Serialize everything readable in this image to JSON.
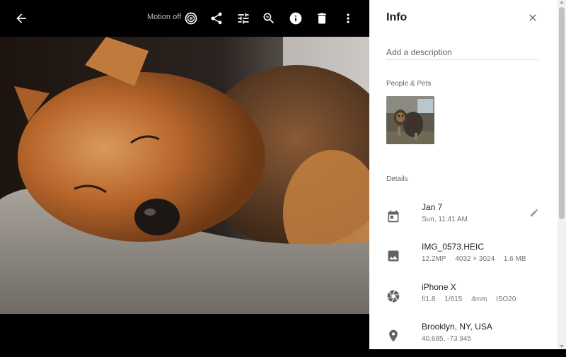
{
  "viewer": {
    "motion_label": "Motion off",
    "icons": {
      "back": "arrow-back-icon",
      "motion": "motion-photo-icon",
      "share": "share-icon",
      "edit": "tune-icon",
      "zoom": "zoom-in-icon",
      "info": "info-icon",
      "delete": "trash-icon",
      "more": "more-vert-icon"
    }
  },
  "panel": {
    "title": "Info",
    "description_placeholder": "Add a description",
    "people_pets_label": "People & Pets",
    "details_label": "Details",
    "details": {
      "date": {
        "primary": "Jan 7",
        "secondary": "Sun, 11:41 AM",
        "icon": "calendar-icon"
      },
      "file": {
        "primary": "IMG_0573.HEIC",
        "secondary": [
          "12.2MP",
          "4032 × 3024",
          "1.6 MB"
        ],
        "icon": "image-icon"
      },
      "camera": {
        "primary": "iPhone X",
        "secondary": [
          "f/1.8",
          "1/615",
          "4mm",
          "ISO20"
        ],
        "icon": "aperture-icon"
      },
      "location": {
        "primary": "Brooklyn, NY, USA",
        "secondary": "40.685, -73.945",
        "icon": "place-icon"
      }
    }
  },
  "colors": {
    "viewer_bg": "#000000",
    "panel_bg": "#ffffff",
    "primary_text": "#202124",
    "secondary_text": "#70757a"
  }
}
